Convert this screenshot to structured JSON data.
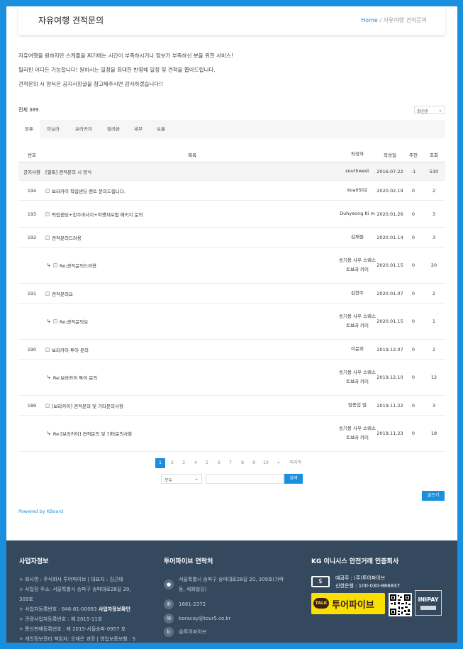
{
  "header": {
    "title": "자유여행 견적문의",
    "crumb_home": "Home",
    "crumb_sep": " / ",
    "crumb_current": "자유여행 견적문의"
  },
  "intro": [
    "자유여행을 원하지만 스케쥴을 짜기에는 시간이 부족하시거나 정보가 부족하신 분을 위한 서비스!",
    "필리핀 어디든 가능합니다! 원하시는 일정을 최대한 반영해 일정 및 견적을 뽑아드립니다.",
    "견적문의 시 양식은 공지사항글을 참고해주시면 감사하겠습니다!!"
  ],
  "total": "전체 389",
  "sort": {
    "selected": "최신순"
  },
  "tabs": [
    "모두",
    "마닐라",
    "보라카이",
    "팔라완",
    "세부",
    "보홀"
  ],
  "table": {
    "headers": {
      "num": "번호",
      "subject": "제목",
      "author": "작성자",
      "date": "작성일",
      "rec": "추천",
      "view": "조회"
    },
    "rows": [
      {
        "num": "공지사항",
        "subject": "[필독] 견적문의 시 양식",
        "author": "southwest",
        "date": "2016.07.22",
        "rec": "-1",
        "view": "530"
      },
      {
        "num": "194",
        "subject": "보라카이 픽업샌딩 렌트 문의드립니다.",
        "author": "koa0502",
        "date": "2020.02.19",
        "rec": "0",
        "view": "2"
      },
      {
        "num": "193",
        "subject": "픽업샌딩+친주마사지+여행자보험 패키지 문의",
        "author": "Duhyeong Ki m",
        "date": "2020.01.26",
        "rec": "0",
        "view": "3"
      },
      {
        "num": "192",
        "subject": "견적문의드려용",
        "author": "김채원",
        "date": "2020.01.14",
        "rec": "0",
        "view": "3"
      },
      {
        "num": "",
        "subject": "Re:견적문의드려용",
        "author": "송기용 사우 스웨스트보라 카이",
        "date": "2020.01.15",
        "rec": "0",
        "view": "20"
      },
      {
        "num": "191",
        "subject": "견적문의요",
        "author": "김현주",
        "date": "2020.01.07",
        "rec": "0",
        "view": "2"
      },
      {
        "num": "",
        "subject": "Re:견적문의요",
        "author": "송기용 사우 스웨스트보라 카이",
        "date": "2020.01.15",
        "rec": "0",
        "view": "1"
      },
      {
        "num": "190",
        "subject": "보라카이 투어 문의",
        "author": "이문희",
        "date": "2019.12.07",
        "rec": "0",
        "view": "2"
      },
      {
        "num": "",
        "subject": "Re:보라카이 투어 문의",
        "author": "송기용 사우 스웨스트보라 카이",
        "date": "2019.12.10",
        "rec": "0",
        "view": "12"
      },
      {
        "num": "189",
        "subject": "[보라카이] 견적문의 및 기타문의사항",
        "author": "엄종섭 엄",
        "date": "2019.11.22",
        "rec": "0",
        "view": "3"
      },
      {
        "num": "",
        "subject": "Re:[보라카이] 견적문의 및 기타문의사항",
        "author": "송기용 사우 스웨스트보라 카이",
        "date": "2019.11.23",
        "rec": "0",
        "view": "18"
      }
    ]
  },
  "pager": [
    "1",
    "2",
    "3",
    "4",
    "5",
    "6",
    "7",
    "8",
    "9",
    "10",
    "»",
    "마지막"
  ],
  "search": {
    "select": "모두",
    "button": "검색"
  },
  "write_button": "글쓰기",
  "powered": "Powered by KBoard",
  "footer": {
    "biz_title": "사업자정보",
    "biz_lines": [
      "+ 회사명 : 주식회사 투어파이브 | 대표자 : 김근태",
      "+ 사업장 주소: 서울특별시 송파구 송파대로28길 20,",
      "309호",
      "+ 사업자등록번호 : 846-81-00083",
      "+ 관광사업자등록번호 : 제 2015-11호",
      "+ 통신판매등록번호 : 제 2015-서울송파-0957 호",
      "+ 개인정보관리 책임자: 오재은 과장 | 영업보증보험 : 5"
    ],
    "biz_link": "사업자정보확인",
    "contact_title": "투어파이브 연락처",
    "contact": [
      "서울특별시 송파구 송파대로28길 20, 309호(가락동, 세화빌딩)",
      "1661-2372",
      "boracay@tour5.co.kr",
      "@투어파이브"
    ],
    "kg_title": "KG 이니시스 안전거래 인증회사",
    "kg_depositor": "예금주 : (주)투어파이브",
    "kg_bank": "신한은행 : 100-030-886837",
    "talk_badge": "TALK",
    "talk_brand": "투어파이브",
    "inipay": "INIPAY"
  },
  "colors": {
    "accent": "#1a8fde",
    "footer_bg": "#34495e"
  }
}
